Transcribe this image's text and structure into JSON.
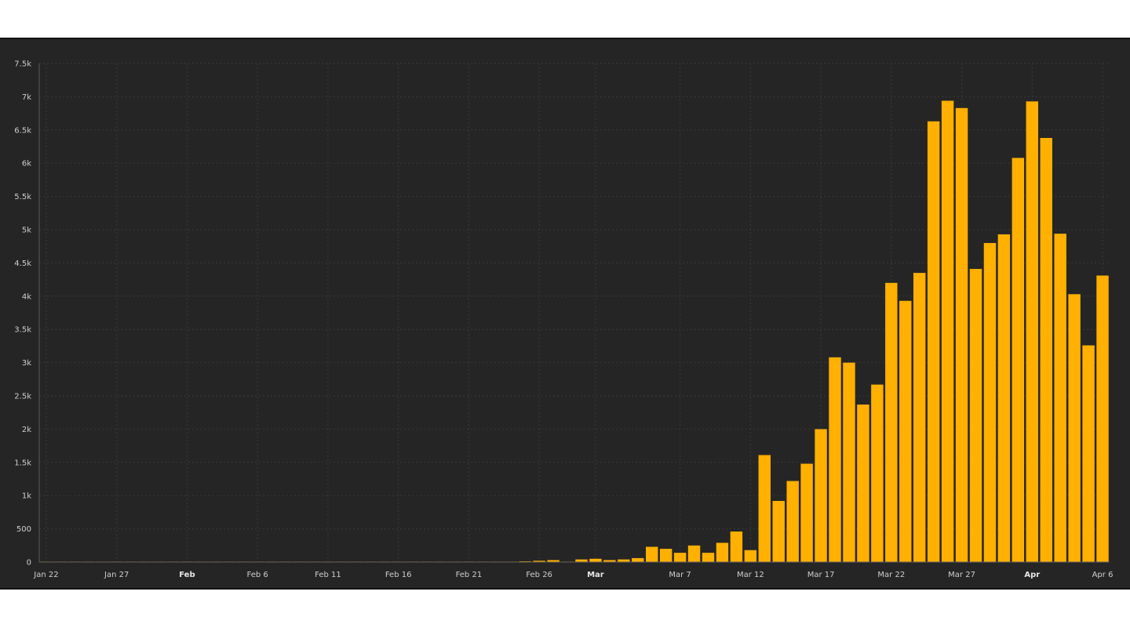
{
  "chart_data": {
    "type": "bar",
    "title": "",
    "xlabel": "",
    "ylabel": "",
    "ylim": [
      0,
      7500
    ],
    "grid": true,
    "bar_color": "#ffb000",
    "background_color": "#252525",
    "y_ticks": [
      {
        "value": 0,
        "label": "0"
      },
      {
        "value": 500,
        "label": "500"
      },
      {
        "value": 1000,
        "label": "1k"
      },
      {
        "value": 1500,
        "label": "1.5k"
      },
      {
        "value": 2000,
        "label": "2k"
      },
      {
        "value": 2500,
        "label": "2.5k"
      },
      {
        "value": 3000,
        "label": "3k"
      },
      {
        "value": 3500,
        "label": "3.5k"
      },
      {
        "value": 4000,
        "label": "4k"
      },
      {
        "value": 4500,
        "label": "4.5k"
      },
      {
        "value": 5000,
        "label": "5k"
      },
      {
        "value": 5500,
        "label": "5.5k"
      },
      {
        "value": 6000,
        "label": "6k"
      },
      {
        "value": 6500,
        "label": "6.5k"
      },
      {
        "value": 7000,
        "label": "7k"
      },
      {
        "value": 7500,
        "label": "7.5k"
      }
    ],
    "x_ticks": [
      {
        "index": 0,
        "label": "Jan 22",
        "bold": false
      },
      {
        "index": 5,
        "label": "Jan 27",
        "bold": false
      },
      {
        "index": 10,
        "label": "Feb",
        "bold": true
      },
      {
        "index": 15,
        "label": "Feb 6",
        "bold": false
      },
      {
        "index": 20,
        "label": "Feb 11",
        "bold": false
      },
      {
        "index": 25,
        "label": "Feb 16",
        "bold": false
      },
      {
        "index": 30,
        "label": "Feb 21",
        "bold": false
      },
      {
        "index": 35,
        "label": "Feb 26",
        "bold": false
      },
      {
        "index": 39,
        "label": "Mar",
        "bold": true
      },
      {
        "index": 45,
        "label": "Mar 7",
        "bold": false
      },
      {
        "index": 50,
        "label": "Mar 12",
        "bold": false
      },
      {
        "index": 55,
        "label": "Mar 17",
        "bold": false
      },
      {
        "index": 60,
        "label": "Mar 22",
        "bold": false
      },
      {
        "index": 65,
        "label": "Mar 27",
        "bold": false
      },
      {
        "index": 70,
        "label": "Apr",
        "bold": true
      },
      {
        "index": 75,
        "label": "Apr 6",
        "bold": false
      }
    ],
    "categories": [
      "2020-01-22",
      "2020-01-23",
      "2020-01-24",
      "2020-01-25",
      "2020-01-26",
      "2020-01-27",
      "2020-01-28",
      "2020-01-29",
      "2020-01-30",
      "2020-01-31",
      "2020-02-01",
      "2020-02-02",
      "2020-02-03",
      "2020-02-04",
      "2020-02-05",
      "2020-02-06",
      "2020-02-07",
      "2020-02-08",
      "2020-02-09",
      "2020-02-10",
      "2020-02-11",
      "2020-02-12",
      "2020-02-13",
      "2020-02-14",
      "2020-02-15",
      "2020-02-16",
      "2020-02-17",
      "2020-02-18",
      "2020-02-19",
      "2020-02-20",
      "2020-02-21",
      "2020-02-22",
      "2020-02-23",
      "2020-02-24",
      "2020-02-25",
      "2020-02-26",
      "2020-02-27",
      "2020-02-28",
      "2020-02-29",
      "2020-03-01",
      "2020-03-02",
      "2020-03-03",
      "2020-03-04",
      "2020-03-05",
      "2020-03-06",
      "2020-03-07",
      "2020-03-08",
      "2020-03-09",
      "2020-03-10",
      "2020-03-11",
      "2020-03-12",
      "2020-03-13",
      "2020-03-14",
      "2020-03-15",
      "2020-03-16",
      "2020-03-17",
      "2020-03-18",
      "2020-03-19",
      "2020-03-20",
      "2020-03-21",
      "2020-03-22",
      "2020-03-23",
      "2020-03-24",
      "2020-03-25",
      "2020-03-26",
      "2020-03-27",
      "2020-03-28",
      "2020-03-29",
      "2020-03-30",
      "2020-03-31",
      "2020-04-01",
      "2020-04-02",
      "2020-04-03",
      "2020-04-04",
      "2020-04-05",
      "2020-04-06"
    ],
    "values": [
      0,
      0,
      0,
      0,
      0,
      0,
      0,
      0,
      0,
      0,
      0,
      0,
      0,
      0,
      0,
      0,
      0,
      0,
      0,
      0,
      0,
      0,
      0,
      0,
      0,
      0,
      0,
      0,
      0,
      0,
      0,
      0,
      0,
      0,
      10,
      20,
      30,
      0,
      40,
      50,
      30,
      40,
      60,
      230,
      200,
      140,
      250,
      140,
      290,
      460,
      180,
      1610,
      920,
      1220,
      1480,
      2000,
      3080,
      3000,
      2370,
      2670,
      4200,
      3930,
      4350,
      6630,
      6940,
      6830,
      4410,
      4800,
      4930,
      6080,
      6930,
      6380,
      4940,
      4030,
      3260,
      4310
    ]
  }
}
